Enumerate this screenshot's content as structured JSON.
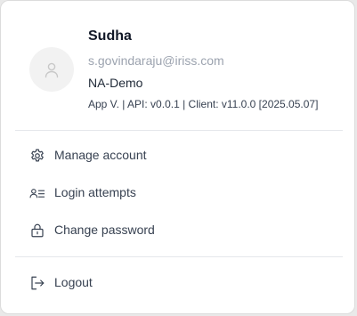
{
  "profile": {
    "name": "Sudha",
    "email": "s.govindaraju@iriss.com",
    "organization": "NA-Demo",
    "version_info": "App V. | API: v0.0.1 | Client: v11.0.0 [2025.05.07]",
    "avatar_icon": "user-avatar-icon"
  },
  "menu": {
    "items": [
      {
        "label": "Manage account",
        "icon": "gear-icon"
      },
      {
        "label": "Login attempts",
        "icon": "user-list-icon"
      },
      {
        "label": "Change password",
        "icon": "lock-icon"
      }
    ],
    "logout": {
      "label": "Logout",
      "icon": "logout-icon"
    }
  },
  "colors": {
    "name": "#111827",
    "email": "#9ca3af",
    "text": "#374151",
    "divider": "#e5e7eb",
    "avatar_bg": "#f2f2f2",
    "panel_bg": "#ffffff"
  }
}
